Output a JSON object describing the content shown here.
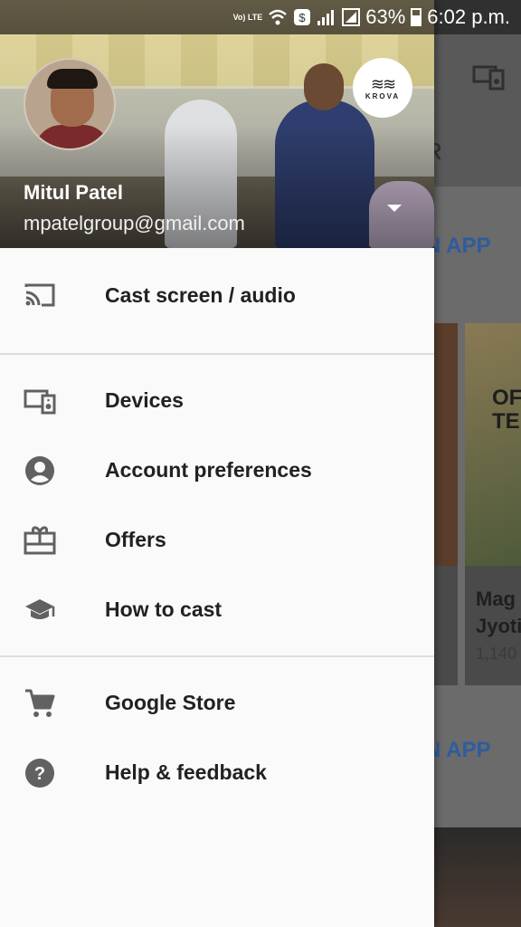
{
  "status_bar": {
    "volte_label": "Vo) LTE",
    "battery": "63%",
    "time": "6:02 p.m."
  },
  "drawer": {
    "account": {
      "name": "Mitul Patel",
      "email": "mpatelgroup@gmail.com"
    },
    "brand_logo": {
      "name": "KROVA"
    },
    "cast_item": {
      "label": "Cast screen / audio",
      "icon": "cast-icon"
    },
    "section1": [
      {
        "label": "Devices",
        "icon": "devices-icon"
      },
      {
        "label": "Account preferences",
        "icon": "account-circle-icon"
      },
      {
        "label": "Offers",
        "icon": "offers-icon"
      },
      {
        "label": "How to cast",
        "icon": "school-icon"
      }
    ],
    "section2": [
      {
        "label": "Google Store",
        "icon": "cart-icon"
      },
      {
        "label": "Help & feedback",
        "icon": "help-icon"
      }
    ]
  },
  "background": {
    "tab_fragment": "R",
    "link1": "N APP",
    "link2": "N APP",
    "card2_overlay": "OF TE",
    "card2_title": "Mag Jyoti",
    "card2_count": "1,140"
  },
  "colors": {
    "drawer_bg": "#fafafa",
    "text": "#212121",
    "icon": "#616161",
    "link": "#2e5c9e"
  }
}
